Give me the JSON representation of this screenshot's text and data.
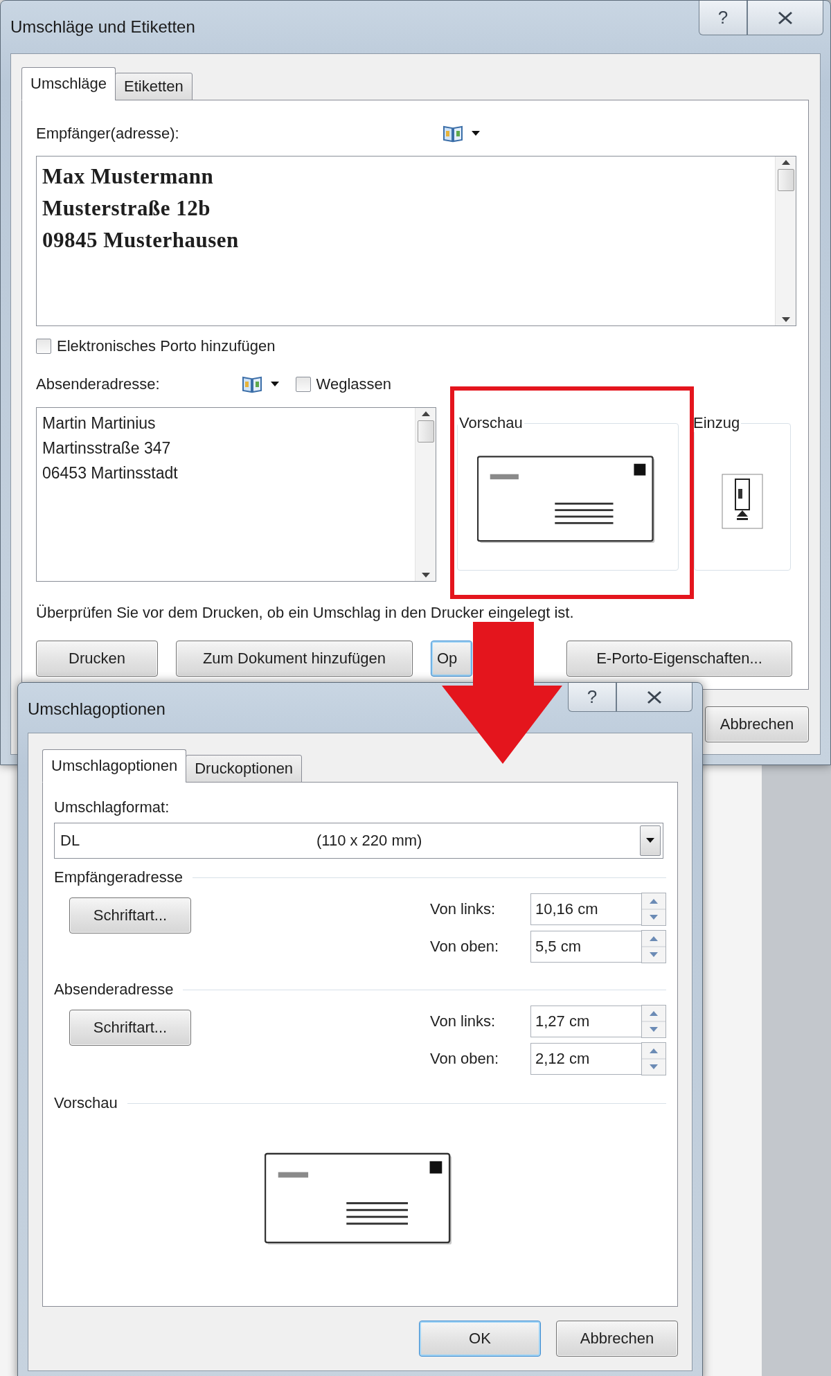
{
  "main_dialog": {
    "title": "Umschläge und Etiketten",
    "help": "?",
    "tabs": [
      {
        "label": "Umschläge",
        "selected": true
      },
      {
        "label": "Etiketten",
        "selected": false
      }
    ],
    "recipient": {
      "label": "Empfänger(adresse):",
      "lines": [
        "Max Mustermann",
        "Musterstraße 12b",
        "09845 Musterhausen"
      ]
    },
    "electronic_postage": {
      "label": "Elektronisches Porto hinzufügen",
      "checked": false
    },
    "sender": {
      "label": "Absenderadresse:",
      "omit": {
        "label": "Weglassen",
        "checked": false
      },
      "lines": [
        "Martin Martinius",
        "Martinsstraße 347",
        "06453 Martinsstadt"
      ]
    },
    "preview": {
      "label": "Vorschau"
    },
    "feed": {
      "label": "Einzug"
    },
    "note": "Überprüfen Sie vor dem Drucken, ob ein Umschlag in den Drucker eingelegt ist.",
    "buttons": [
      {
        "label": "Drucken",
        "default": false
      },
      {
        "label": "Zum Dokument hinzufügen",
        "default": false
      },
      {
        "label": "Op",
        "default": true
      },
      {
        "label": "E-Porto-Eigenschaften...",
        "default": false
      }
    ],
    "cancel_button": {
      "label": "Abbrechen",
      "default": false
    }
  },
  "options_dialog": {
    "title": "Umschlagoptionen",
    "help": "?",
    "tabs": [
      {
        "label": "Umschlagoptionen",
        "selected": true
      },
      {
        "label": "Druckoptionen",
        "selected": false
      }
    ],
    "format": {
      "label": "Umschlagformat:",
      "name": "DL",
      "size": "(110 x 220 mm)"
    },
    "sections": [
      {
        "heading": "Empfängeradresse",
        "font_button": "Schriftart...",
        "fields": [
          {
            "label": "Von links:",
            "value": "10,16 cm"
          },
          {
            "label": "Von oben:",
            "value": "5,5 cm"
          }
        ]
      },
      {
        "heading": "Absenderadresse",
        "font_button": "Schriftart...",
        "fields": [
          {
            "label": "Von links:",
            "value": "1,27 cm"
          },
          {
            "label": "Von oben:",
            "value": "2,12 cm"
          }
        ]
      }
    ],
    "preview": {
      "label": "Vorschau"
    },
    "buttons": [
      {
        "label": "OK",
        "default": true
      },
      {
        "label": "Abbrechen",
        "default": false
      }
    ]
  }
}
